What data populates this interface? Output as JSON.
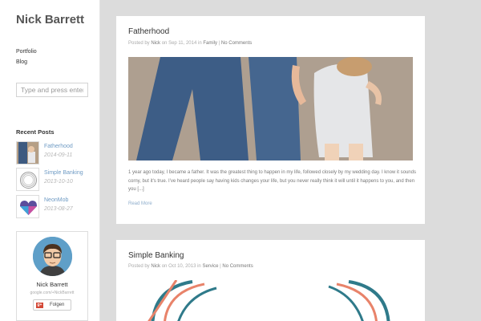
{
  "site": {
    "title": "Nick Barrett"
  },
  "nav": [
    "Portfolio",
    "Blog"
  ],
  "search": {
    "placeholder": "Type and press enter"
  },
  "recent_posts": {
    "heading": "Recent Posts",
    "items": [
      {
        "title": "Fatherhood",
        "date": "2014-09-11",
        "icon": "photo-thumbnail"
      },
      {
        "title": "Simple Banking",
        "date": "2013-10-10",
        "icon": "circle-thumbnail"
      },
      {
        "title": "NeonMob",
        "date": "2013-08-27",
        "icon": "heart-logo-thumbnail"
      }
    ]
  },
  "google_card": {
    "name": "Nick Barrett",
    "url": "google.com/+NickBarrett",
    "button": "Folgen",
    "button_icon": "g+"
  },
  "posts": [
    {
      "title": "Fatherhood",
      "meta": {
        "prefix": "Posted by",
        "author": "Nick",
        "on": "on",
        "date": "Sep 11, 2014",
        "in": "in",
        "category": "Family",
        "sep": "|",
        "comments": "No Comments"
      },
      "excerpt": "1 year ago today, I became a father. It was the greatest thing to happen in my life, followed closely by my wedding day. I know it sounds corny, but it's true. I've heard people say having kids changes your life, but you never really think it will until it happens to you, and then you [...]",
      "read_more": "Read More"
    },
    {
      "title": "Simple Banking",
      "meta": {
        "prefix": "Posted by",
        "author": "Nick",
        "on": "on",
        "date": "Oct 10, 2013",
        "in": "in",
        "category": "Service",
        "sep": "|",
        "comments": "No Comments"
      }
    }
  ],
  "colors": {
    "link": "#6f9bc4",
    "background": "#dcdcdc",
    "meta": "#aaaaaa"
  }
}
